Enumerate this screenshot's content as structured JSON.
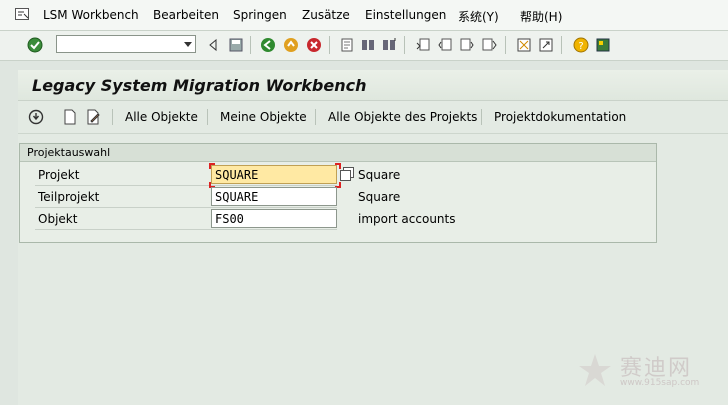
{
  "menubar": {
    "items": [
      "LSM Workbench",
      "Bearbeiten",
      "Springen",
      "Zusätze",
      "Einstellungen",
      "系统(Y)",
      "帮助(H)"
    ]
  },
  "toolbar": {
    "command_field_value": ""
  },
  "title": "Legacy System Migration Workbench",
  "app_toolbar": {
    "buttons": [
      "Alle Objekte",
      "Meine Objekte",
      "Alle Objekte des Projekts",
      "Projektdokumentation"
    ]
  },
  "selection": {
    "group_title": "Projektauswahl",
    "rows": [
      {
        "label": "Projekt",
        "value": "SQUARE",
        "description": "Square"
      },
      {
        "label": "Teilprojekt",
        "value": "SQUARE",
        "description": "Square"
      },
      {
        "label": "Objekt",
        "value": "FS00",
        "description": "import accounts"
      }
    ]
  },
  "watermark": {
    "text": "赛迪网",
    "url": "www.915sap.com"
  }
}
